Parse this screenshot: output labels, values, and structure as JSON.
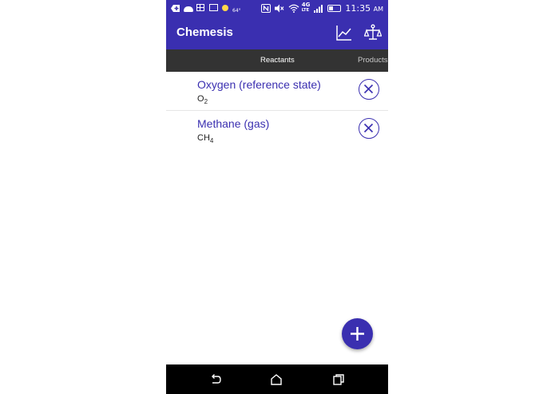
{
  "status_bar": {
    "temperature": "64°",
    "network": "4G",
    "network_sub": "LTE",
    "time": "11:35",
    "time_suffix": "AM",
    "icons": [
      "add-icon",
      "cloud-icon",
      "calendar-icon",
      "keyboard-icon",
      "weather-sun-icon",
      "nfc-icon",
      "mute-icon",
      "wifi-icon",
      "signal-icon",
      "battery-icon"
    ]
  },
  "app_bar": {
    "title": "Chemesis",
    "actions": [
      "chart-icon",
      "balance-icon"
    ],
    "color": "#3a2fb0"
  },
  "tabs": [
    {
      "label": "Reactants",
      "selected": true
    },
    {
      "label": "Products",
      "selected": false
    }
  ],
  "reactants": [
    {
      "name": "Oxygen (reference state)",
      "formula_base": "O",
      "formula_sub": "2"
    },
    {
      "name": "Methane (gas)",
      "formula_base": "CH",
      "formula_sub": "4"
    }
  ],
  "fab": {
    "icon": "plus-icon"
  },
  "nav_bar": {
    "icons": [
      "back-icon",
      "home-icon",
      "recent-apps-icon"
    ]
  }
}
